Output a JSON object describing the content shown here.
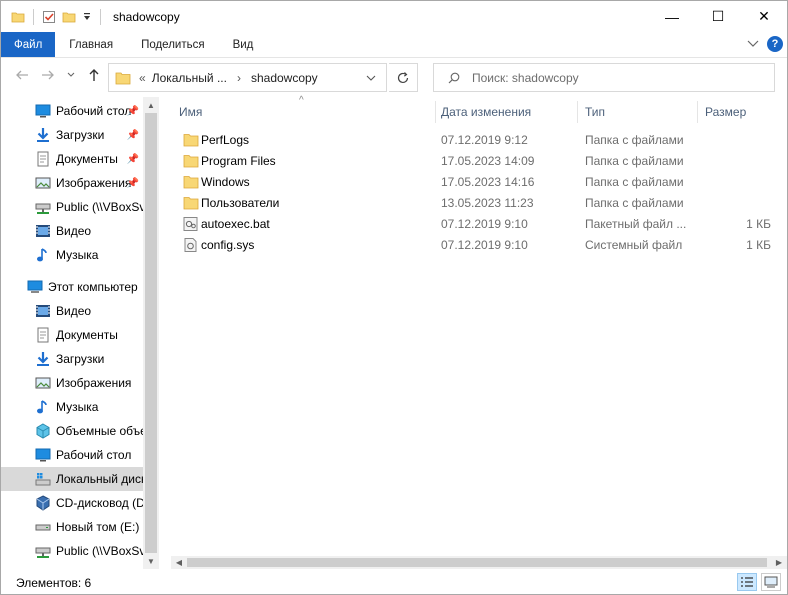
{
  "window": {
    "title": "shadowcopy",
    "minimize_glyph": "—",
    "maximize_glyph": "☐",
    "close_glyph": "✕"
  },
  "ribbon": {
    "tabs": [
      "Файл",
      "Главная",
      "Поделиться",
      "Вид"
    ],
    "help_glyph": "?"
  },
  "address": {
    "overflow": "«",
    "crumbs": [
      "Локальный ...",
      "shadowcopy"
    ],
    "separator": "›"
  },
  "search": {
    "placeholder": "Поиск: shadowcopy"
  },
  "navigation": {
    "quick_access": [
      {
        "label": "Рабочий стол",
        "icon": "desktop-icon",
        "pinned": true
      },
      {
        "label": "Загрузки",
        "icon": "downloads-icon",
        "pinned": true
      },
      {
        "label": "Документы",
        "icon": "documents-icon",
        "pinned": true
      },
      {
        "label": "Изображения",
        "icon": "pictures-icon",
        "pinned": true
      },
      {
        "label": "Public (\\\\VBoxSvr)",
        "icon": "network-drive-icon",
        "pinned": false
      },
      {
        "label": "Видео",
        "icon": "videos-icon",
        "pinned": false
      },
      {
        "label": "Музыка",
        "icon": "music-icon",
        "pinned": false
      }
    ],
    "this_pc": {
      "label": "Этот компьютер",
      "icon": "computer-icon"
    },
    "pc_items": [
      {
        "label": "Видео",
        "icon": "videos-icon"
      },
      {
        "label": "Документы",
        "icon": "documents-icon"
      },
      {
        "label": "Загрузки",
        "icon": "downloads-icon"
      },
      {
        "label": "Изображения",
        "icon": "pictures-icon"
      },
      {
        "label": "Музыка",
        "icon": "music-icon"
      },
      {
        "label": "Объемные объекты",
        "icon": "3d-objects-icon"
      },
      {
        "label": "Рабочий стол",
        "icon": "desktop-icon"
      },
      {
        "label": "Локальный диск (C:)",
        "icon": "local-disk-icon",
        "selected": true
      },
      {
        "label": "CD-дисковод (D:)",
        "icon": "cd-drive-icon"
      },
      {
        "label": "Новый том (E:)",
        "icon": "drive-icon"
      },
      {
        "label": "Public (\\\\VBoxSvr)",
        "icon": "network-drive-icon"
      }
    ]
  },
  "columns": {
    "name": "Имя",
    "date": "Дата изменения",
    "type": "Тип",
    "size": "Размер",
    "sort_glyph": "^"
  },
  "files": [
    {
      "name": "PerfLogs",
      "date": "07.12.2019 9:12",
      "type": "Папка с файлами",
      "size": "",
      "icon": "folder-icon"
    },
    {
      "name": "Program Files",
      "date": "17.05.2023 14:09",
      "type": "Папка с файлами",
      "size": "",
      "icon": "folder-icon"
    },
    {
      "name": "Windows",
      "date": "17.05.2023 14:16",
      "type": "Папка с файлами",
      "size": "",
      "icon": "folder-icon"
    },
    {
      "name": "Пользователи",
      "date": "13.05.2023 11:23",
      "type": "Папка с файлами",
      "size": "",
      "icon": "folder-icon"
    },
    {
      "name": "autoexec.bat",
      "date": "07.12.2019 9:10",
      "type": "Пакетный файл ...",
      "size": "1 КБ",
      "icon": "batch-file-icon"
    },
    {
      "name": "config.sys",
      "date": "07.12.2019 9:10",
      "type": "Системный файл",
      "size": "1 КБ",
      "icon": "system-file-icon"
    }
  ],
  "status": {
    "items_count": "Элементов: 6"
  },
  "colors": {
    "accent": "#1a66c6",
    "folder": "#f8d775",
    "selected": "#d9d9d9"
  }
}
